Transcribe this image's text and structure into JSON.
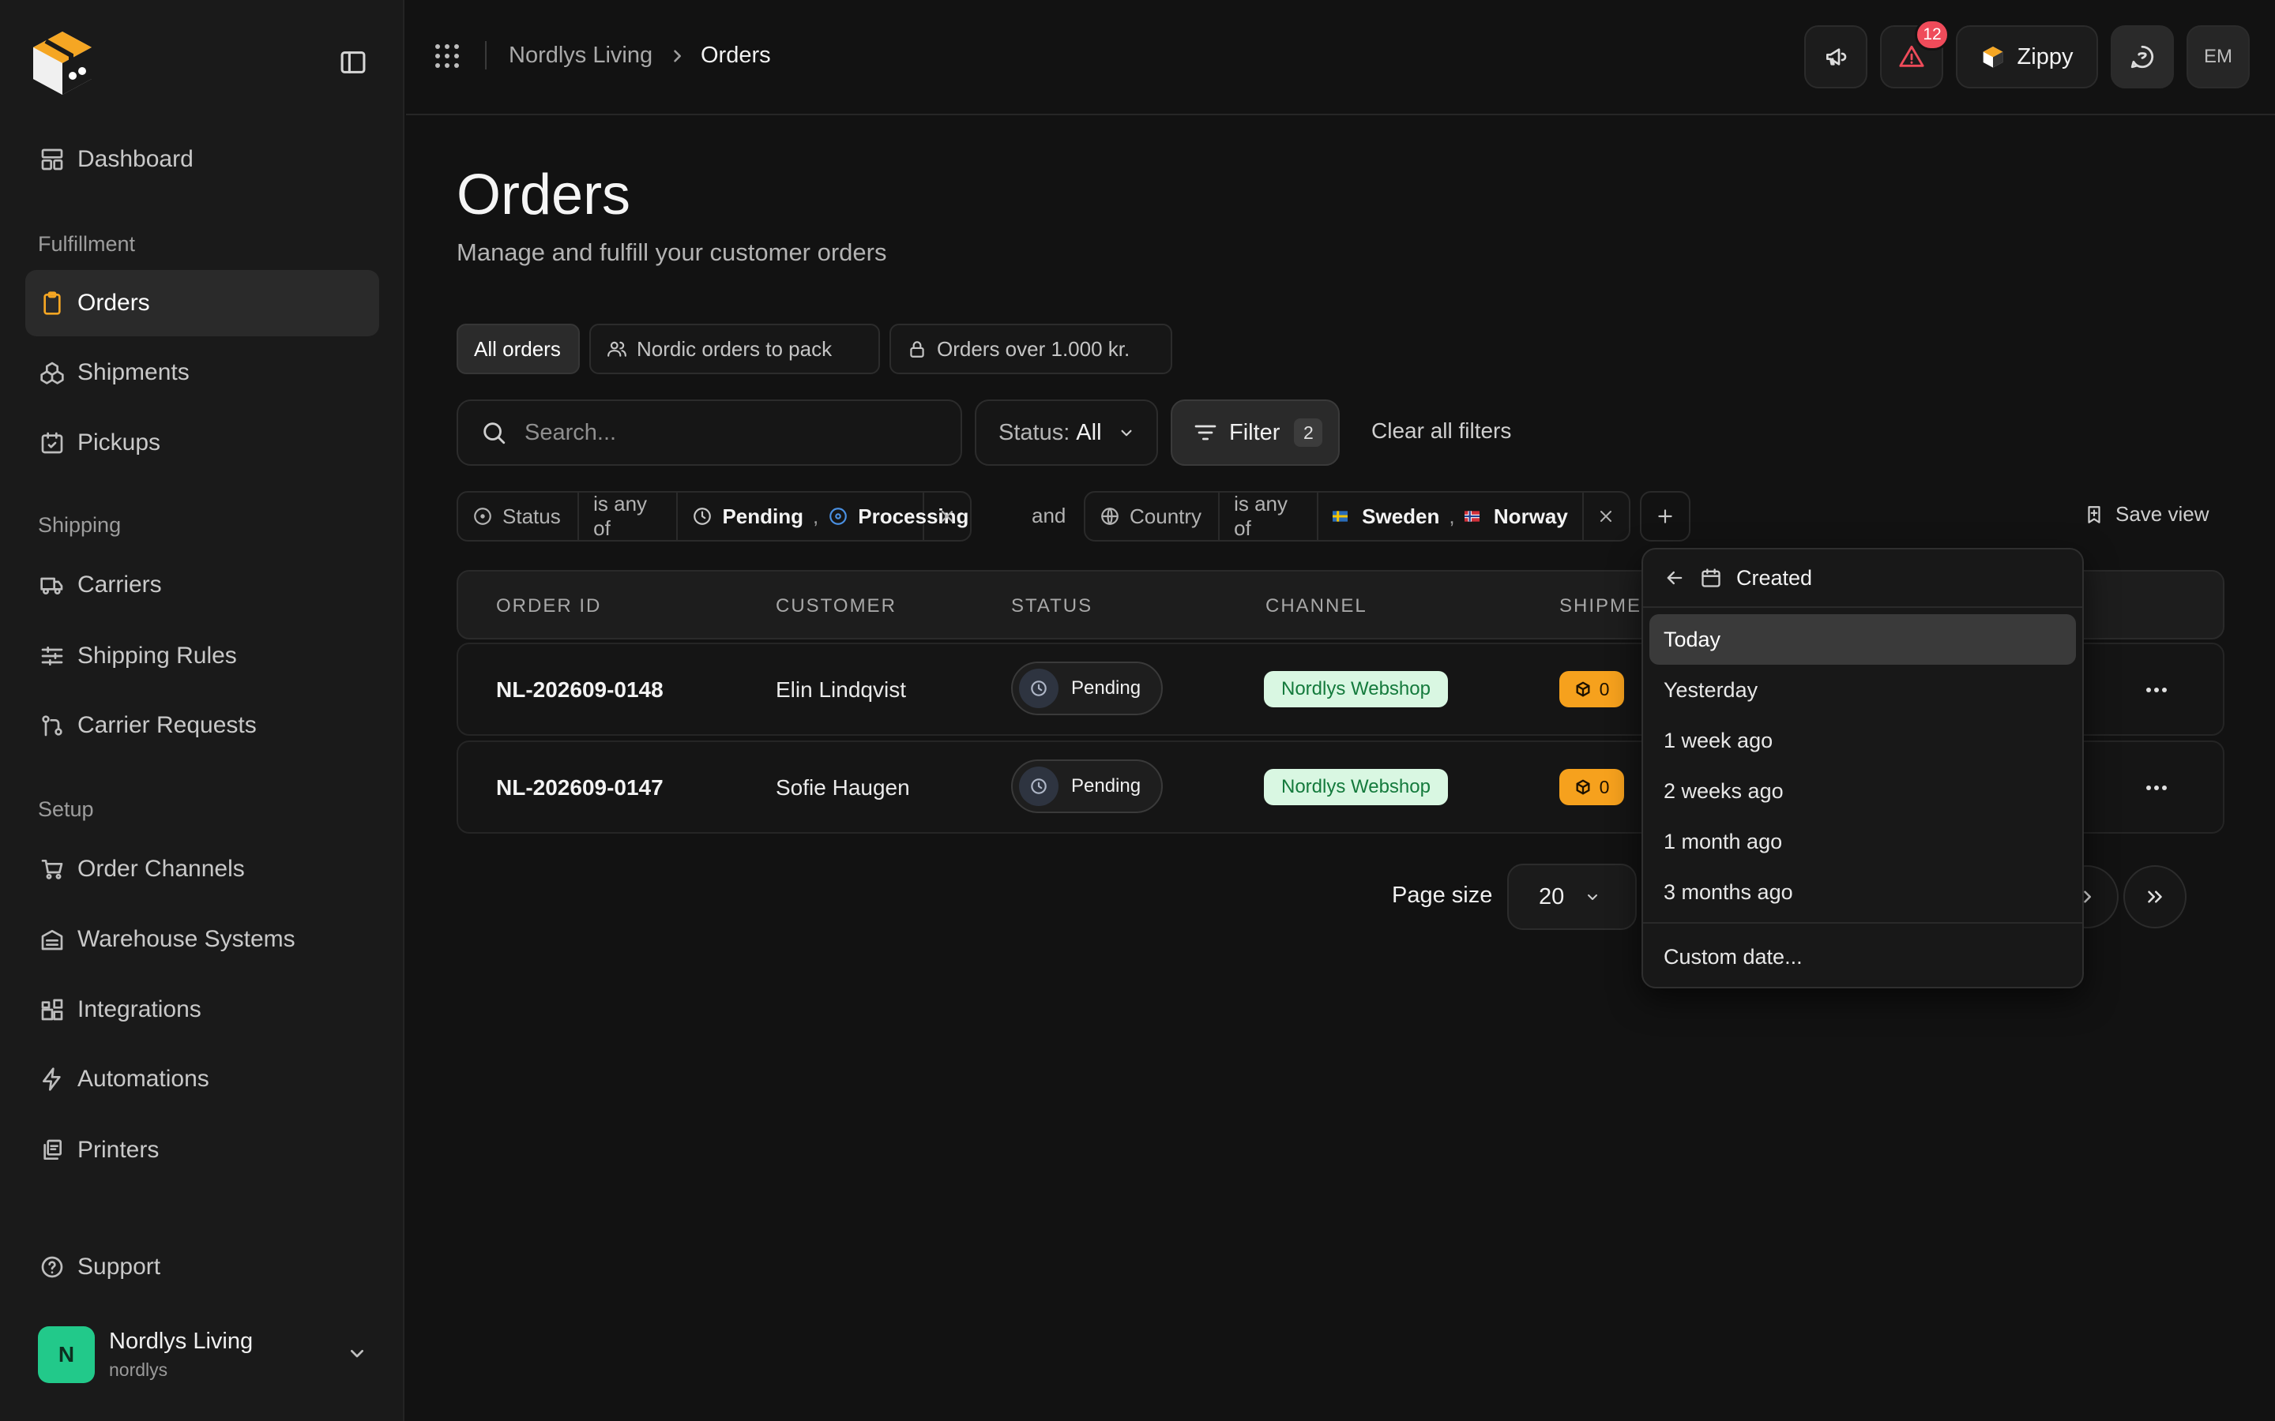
{
  "sidebar": {
    "nav_top": {
      "dashboard": "Dashboard"
    },
    "sections": {
      "fulfillment": "Fulfillment",
      "shipping": "Shipping",
      "setup": "Setup"
    },
    "items": {
      "orders": "Orders",
      "shipments": "Shipments",
      "pickups": "Pickups",
      "carriers": "Carriers",
      "shipping_rules": "Shipping Rules",
      "carrier_requests": "Carrier Requests",
      "order_channels": "Order Channels",
      "warehouse_systems": "Warehouse Systems",
      "integrations": "Integrations",
      "automations": "Automations",
      "printers": "Printers",
      "support": "Support"
    },
    "account": {
      "initial": "N",
      "name": "Nordlys Living",
      "handle": "nordlys"
    }
  },
  "topbar": {
    "breadcrumb": [
      "Nordlys Living",
      "Orders"
    ],
    "alerts_count": "12",
    "zippy_label": "Zippy",
    "user_initials": "EM"
  },
  "page": {
    "title": "Orders",
    "subtitle": "Manage and fulfill your customer orders"
  },
  "views": {
    "all": "All orders",
    "nordic": "Nordic orders to pack",
    "over": "Orders over 1.000 kr."
  },
  "toolbar": {
    "search_placeholder": "Search...",
    "status_label": "Status:",
    "status_value": "All",
    "filter_label": "Filter",
    "filter_count": "2",
    "clear_label": "Clear all filters"
  },
  "filters": {
    "status": {
      "field": "Status",
      "op": "is any of",
      "values": [
        "Pending",
        "Processing"
      ]
    },
    "joiner": "and",
    "country": {
      "field": "Country",
      "op": "is any of",
      "values": [
        "Sweden",
        "Norway"
      ]
    },
    "save_view": "Save view"
  },
  "table": {
    "columns": [
      "ORDER ID",
      "CUSTOMER",
      "STATUS",
      "CHANNEL",
      "SHIPME"
    ],
    "rows": [
      {
        "id": "NL-202609-0148",
        "customer": "Elin Lindqvist",
        "status": "Pending",
        "channel": "Nordlys Webshop",
        "shipments": "0"
      },
      {
        "id": "NL-202609-0147",
        "customer": "Sofie Haugen",
        "status": "Pending",
        "channel": "Nordlys Webshop",
        "shipments": "0"
      }
    ]
  },
  "pagination": {
    "page_size_label": "Page size",
    "page_size": "20"
  },
  "date_menu": {
    "title": "Created",
    "options": [
      "Today",
      "Yesterday",
      "1 week ago",
      "2 weeks ago",
      "1 month ago",
      "3 months ago"
    ],
    "custom": "Custom date..."
  },
  "colors": {
    "accent": "#f5a623",
    "alert_badge": "#ef4b5a",
    "channel_bg": "#d9f7e2",
    "channel_text": "#147a3c",
    "shipment_badge": "#f6a11d",
    "avatar": "#22c98a"
  }
}
